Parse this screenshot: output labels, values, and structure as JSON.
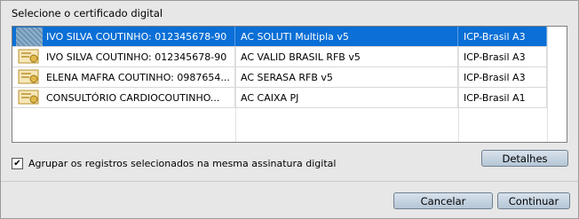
{
  "dialog": {
    "title": "Selecione o certificado digital",
    "rows": [
      {
        "name": "IVO SILVA COUTINHO: 012345678-90",
        "issuer": "AC SOLUTI Multipla v5",
        "type": "ICP-Brasil A3",
        "selected": true
      },
      {
        "name": "IVO SILVA COUTINHO: 012345678-90",
        "issuer": "AC VALID BRASIL RFB v5",
        "type": "ICP-Brasil A3",
        "selected": false
      },
      {
        "name": "ELENA MAFRA COUTINHO: 0987654...",
        "issuer": "AC SERASA RFB v5",
        "type": "ICP-Brasil A3",
        "selected": false
      },
      {
        "name": "CONSULTÓRIO CARDIOCOUTINHO...",
        "issuer": "AC CAIXA PJ",
        "type": "ICP-Brasil A1",
        "selected": false
      }
    ],
    "checkbox_label": "Agrupar os registros selecionados na mesma assinatura digital",
    "checkbox_checked": "✔",
    "details_label": "Detalhes",
    "cancel_label": "Cancelar",
    "continue_label": "Continuar",
    "icon_names": [
      "certificate-icon"
    ],
    "colors": {
      "selection": "#0a6fd6",
      "button": "#c3d1df"
    }
  }
}
